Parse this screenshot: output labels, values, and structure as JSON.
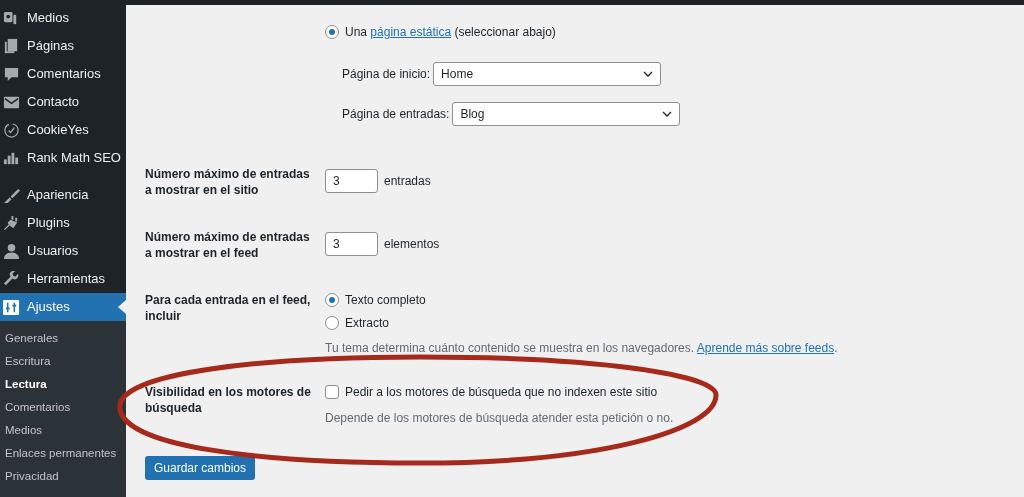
{
  "sidebar": {
    "menu_groups": [
      [
        {
          "label": "Medios",
          "kind": "media",
          "selected": false
        },
        {
          "label": "Páginas",
          "kind": "pages",
          "selected": false
        },
        {
          "label": "Comentarios",
          "kind": "comment",
          "selected": false
        },
        {
          "label": "Contacto",
          "kind": "mail",
          "selected": false
        },
        {
          "label": "CookieYes",
          "kind": "cookie",
          "selected": false
        },
        {
          "label": "Rank Math SEO",
          "kind": "chart",
          "selected": false
        }
      ],
      [
        {
          "label": "Apariencia",
          "kind": "brush",
          "selected": false
        },
        {
          "label": "Plugins",
          "kind": "plug",
          "selected": false
        },
        {
          "label": "Usuarios",
          "kind": "user",
          "selected": false
        },
        {
          "label": "Herramientas",
          "kind": "wrench",
          "selected": false
        },
        {
          "label": "Ajustes",
          "kind": "sliders",
          "selected": true
        }
      ]
    ],
    "submenu": [
      {
        "label": "Generales",
        "selected": false
      },
      {
        "label": "Escritura",
        "selected": false
      },
      {
        "label": "Lectura",
        "selected": true
      },
      {
        "label": "Comentarios",
        "selected": false
      },
      {
        "label": "Medios",
        "selected": false
      },
      {
        "label": "Enlaces permanentes",
        "selected": false
      },
      {
        "label": "Privacidad",
        "selected": false
      }
    ]
  },
  "settings": [
    {
      "kind": "front_page",
      "option": {
        "before": "Una ",
        "link": "página estática",
        "after": " (seleccionar abajo)",
        "selected": true
      },
      "selects": [
        {
          "label": "Página de inicio:",
          "value": "Home"
        },
        {
          "label": "Página de entradas:",
          "value": "Blog"
        }
      ]
    },
    {
      "kind": "number",
      "label": "Número máximo de entradas a mostrar en el sitio",
      "value": "3",
      "unit": "entradas"
    },
    {
      "kind": "number",
      "label": "Número máximo de entradas a mostrar en el feed",
      "value": "3",
      "unit": "elementos"
    },
    {
      "kind": "radios",
      "label": "Para cada entrada en el feed, incluir",
      "options": [
        {
          "label": "Texto completo",
          "selected": true
        },
        {
          "label": "Extracto",
          "selected": false
        }
      ],
      "description": "Tu tema determina cuánto contenido se muestra en los navegadores.",
      "link": "Aprende más sobre feeds",
      "after": "."
    },
    {
      "kind": "checkbox",
      "label": "Visibilidad en los motores de búsqueda",
      "option": "Pedir a los motores de búsqueda que no indexen este sitio",
      "checked": false,
      "description": "Depende de los motores de búsqueda atender esta petición o no."
    }
  ],
  "save_button": "Guardar cambios"
}
